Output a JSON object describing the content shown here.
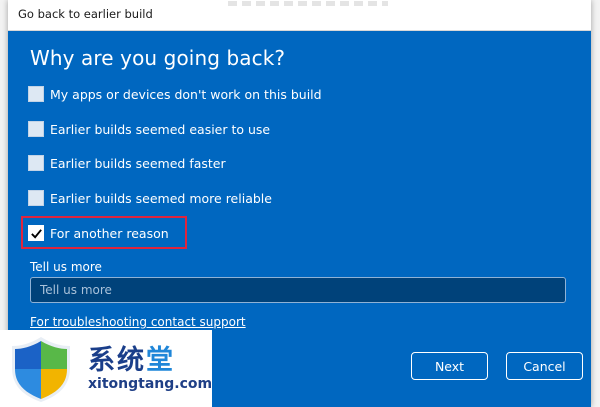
{
  "window": {
    "title": "Go back to earlier build"
  },
  "dialog": {
    "heading": "Why are you going back?",
    "options": [
      {
        "label": "My apps or devices don't work on this build",
        "checked": false
      },
      {
        "label": "Earlier builds seemed easier to use",
        "checked": false
      },
      {
        "label": "Earlier builds seemed faster",
        "checked": false
      },
      {
        "label": "Earlier builds seemed more reliable",
        "checked": false
      },
      {
        "label": "For another reason",
        "checked": true
      }
    ],
    "tell_us_label": "Tell us more",
    "tell_us_placeholder": "Tell us more",
    "tell_us_value": "",
    "support_link": "For troubleshooting contact support",
    "next_label": "Next",
    "cancel_label": "Cancel"
  },
  "watermark": {
    "chars": "系统",
    "accent_char": "堂",
    "url": "xitongtang.com"
  },
  "colors": {
    "dialog_bg": "#0067c0",
    "highlight_border": "#e0243d",
    "input_bg": "#00427a"
  },
  "icons": {
    "check": "checkmark-icon",
    "logo": "shield-logo-icon"
  }
}
